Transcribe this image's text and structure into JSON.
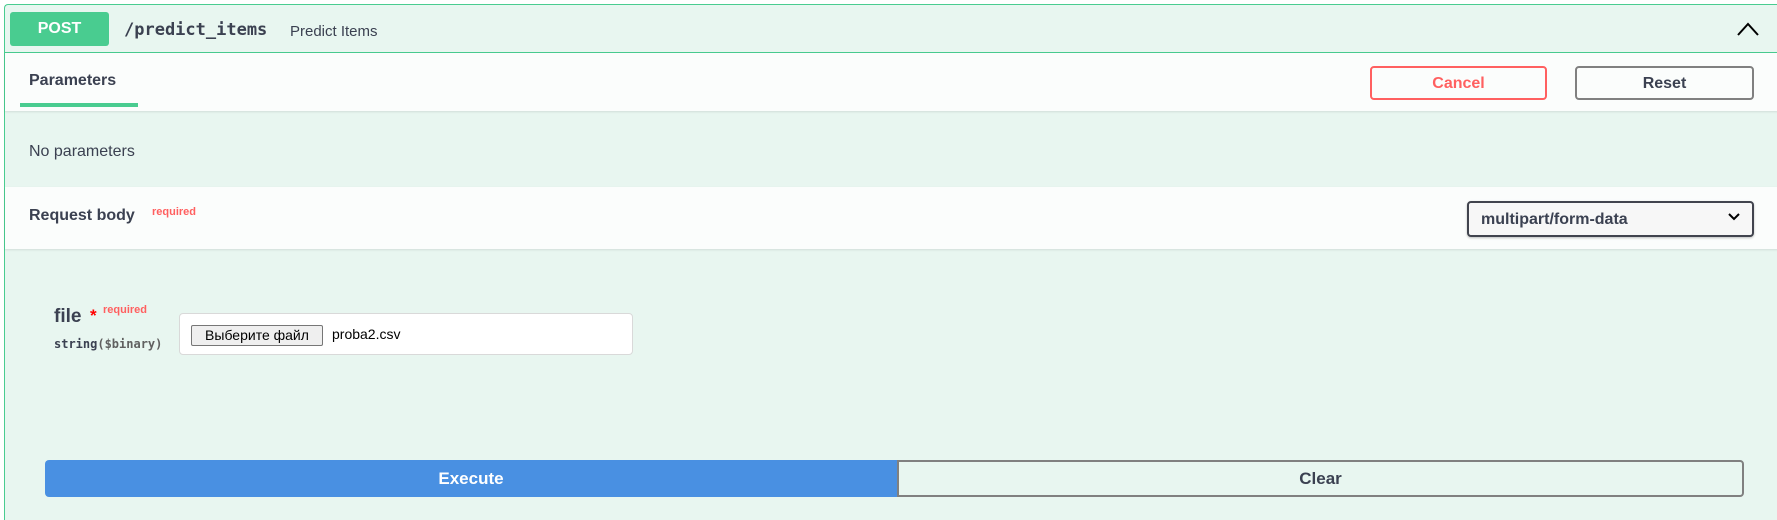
{
  "summary": {
    "method": "POST",
    "path": "/predict_items",
    "description": "Predict Items",
    "collapse_icon": "chevron-up-icon"
  },
  "parameters": {
    "tab_label": "Parameters",
    "cancel_label": "Cancel",
    "reset_label": "Reset",
    "empty_text": "No parameters"
  },
  "request_body": {
    "title": "Request body",
    "required_label": "required",
    "content_type": "multipart/form-data",
    "dropdown_icon": "chevron-down-icon"
  },
  "file_param": {
    "name": "file",
    "required_star": "*",
    "required_label": "required",
    "type": "string",
    "format": "($binary)",
    "choose_button": "Выберите файл",
    "chosen_file": "proba2.csv"
  },
  "actions": {
    "execute_label": "Execute",
    "clear_label": "Clear"
  },
  "colors": {
    "post_accent": "#49cc90",
    "post_background": "#e8f6f0",
    "execute_blue": "#4990e2",
    "danger_red": "#ff6060"
  }
}
